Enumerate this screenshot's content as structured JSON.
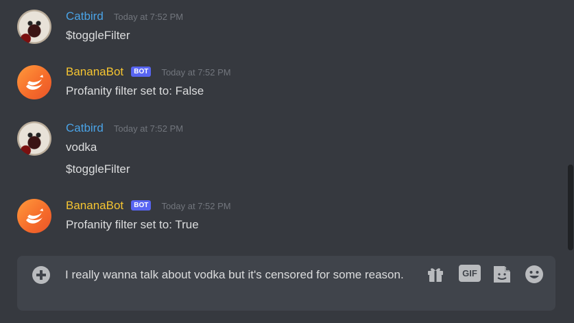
{
  "messages": [
    {
      "author": "Catbird",
      "is_bot": false,
      "timestamp": "Today at 7:52 PM",
      "lines": [
        "$toggleFilter"
      ]
    },
    {
      "author": "BananaBot",
      "is_bot": true,
      "bot_tag": "BOT",
      "timestamp": "Today at 7:52 PM",
      "lines": [
        "Profanity filter set to: False"
      ]
    },
    {
      "author": "Catbird",
      "is_bot": false,
      "timestamp": "Today at 7:52 PM",
      "lines": [
        "vodka",
        "$toggleFilter"
      ]
    },
    {
      "author": "BananaBot",
      "is_bot": true,
      "bot_tag": "BOT",
      "timestamp": "Today at 7:52 PM",
      "lines": [
        "Profanity filter set to: True"
      ]
    }
  ],
  "composer": {
    "value": "I really wanna talk about vodka but it's censored for some reason.",
    "gif_label": "GIF"
  },
  "colors": {
    "background": "#36393f",
    "composer_bg": "#40444b",
    "catbird_name": "#4aa3e6",
    "bananabot_name": "#f6c531",
    "bot_tag": "#5865f2",
    "timestamp": "#72767d",
    "text": "#dcddde"
  },
  "icons": {
    "add": "add-attachment-icon",
    "gift": "gift-icon",
    "gif": "gif-icon",
    "sticker": "sticker-icon",
    "emoji": "emoji-icon"
  }
}
